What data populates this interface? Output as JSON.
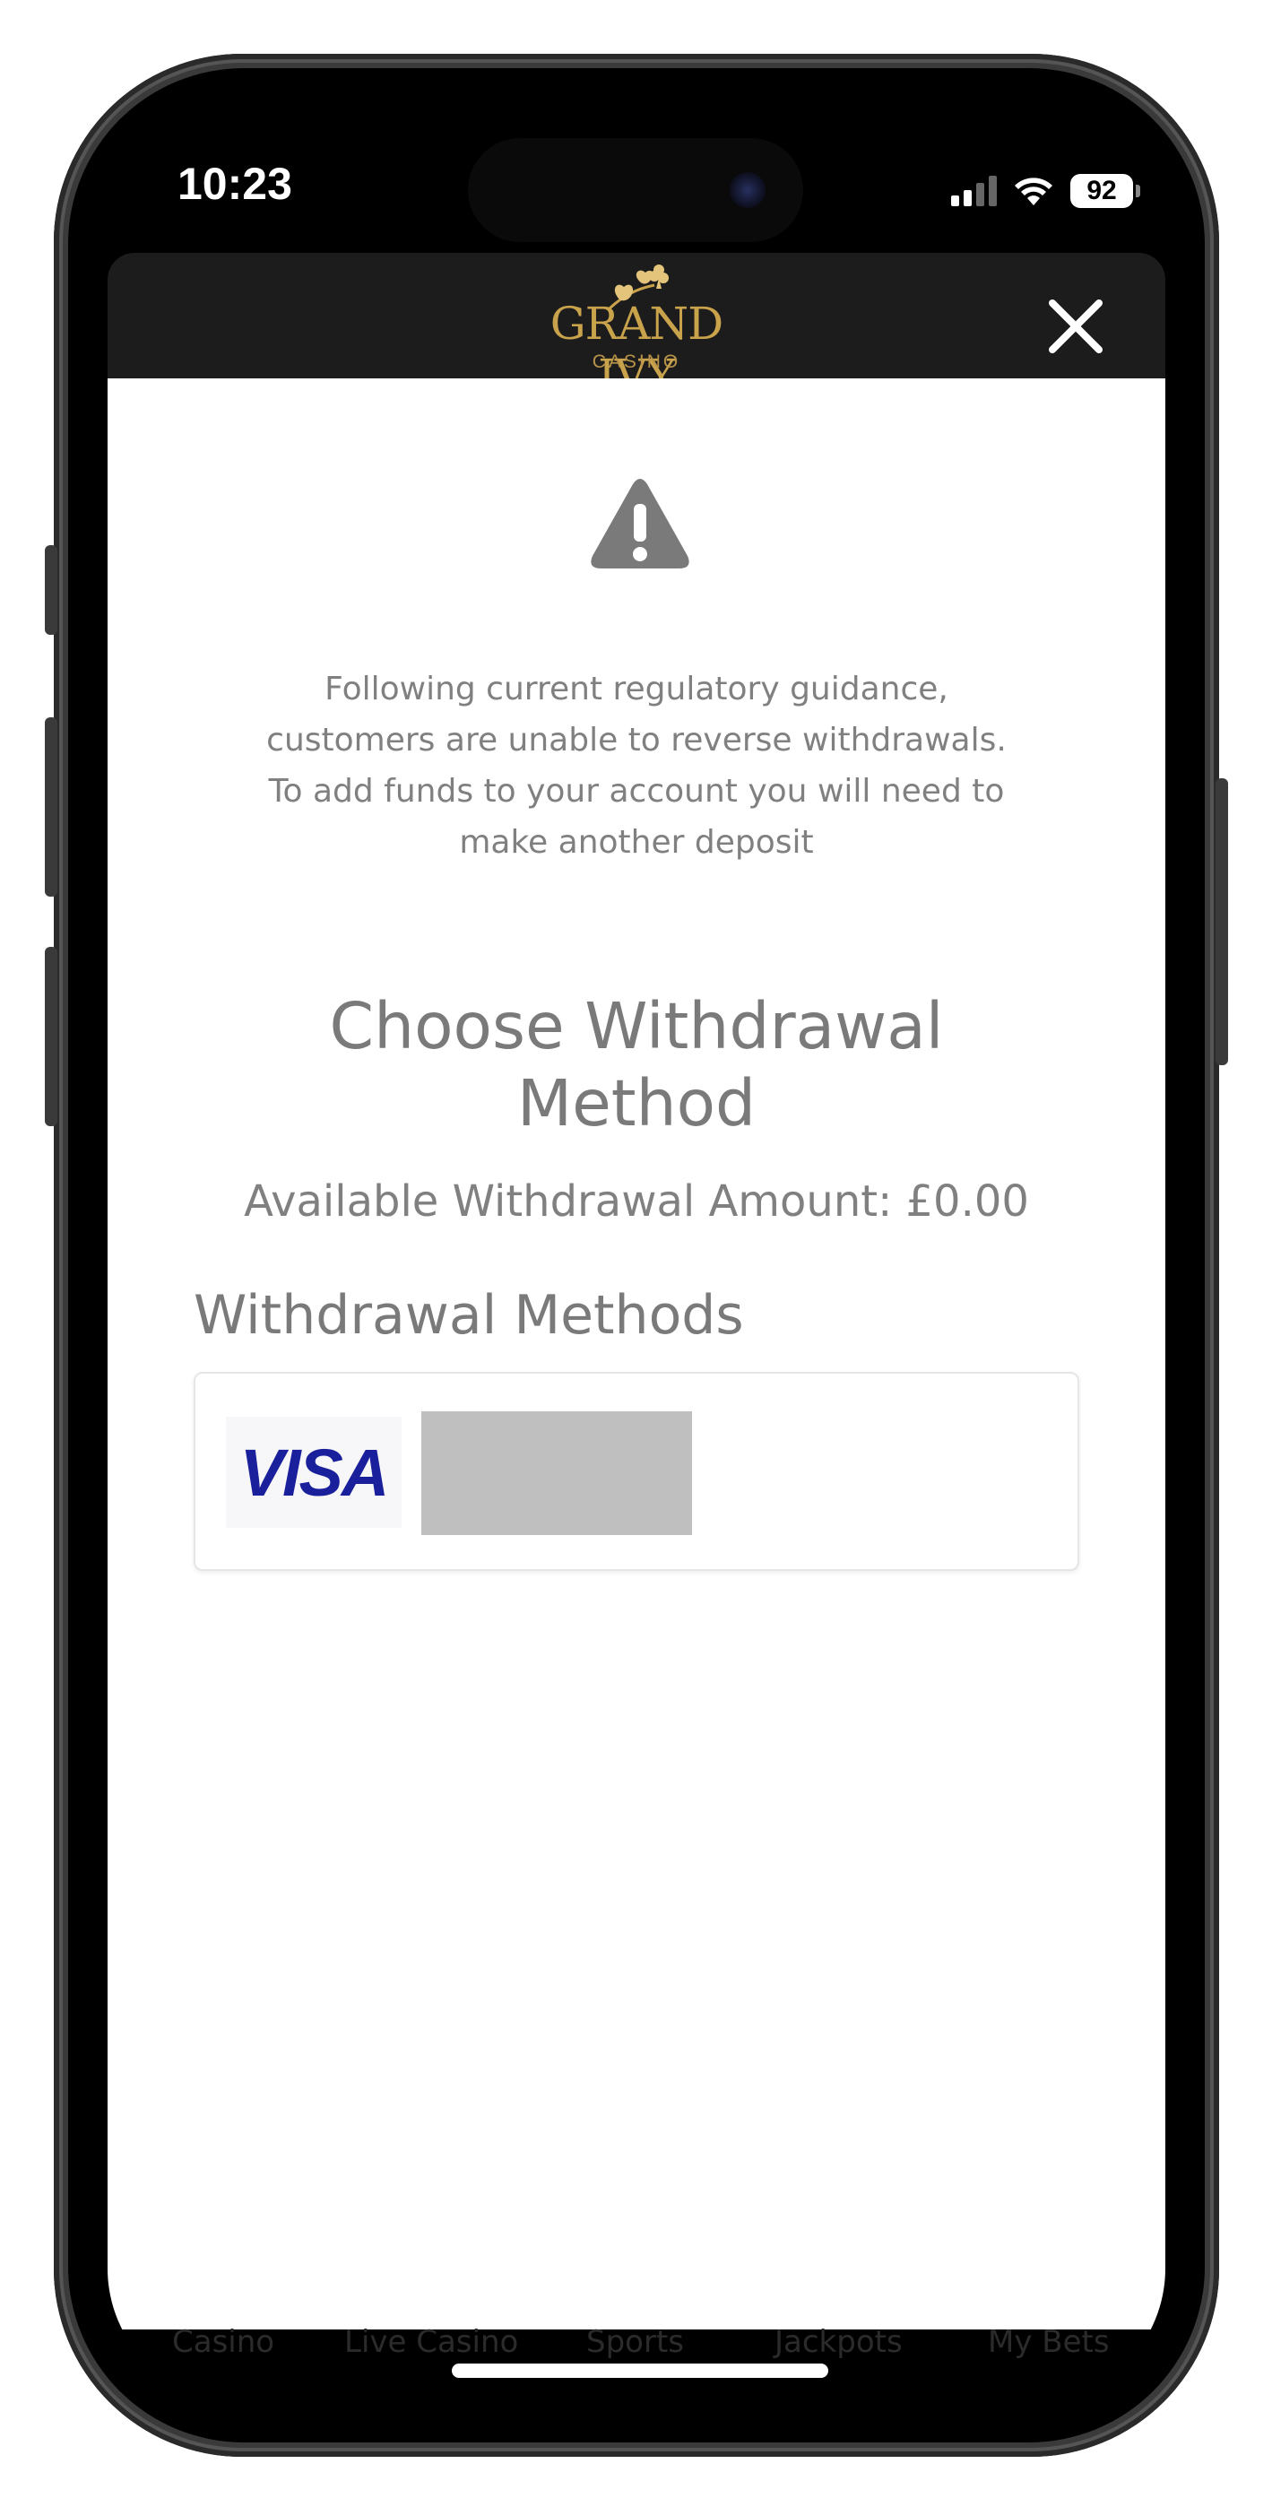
{
  "status_bar": {
    "time": "10:23",
    "battery": "92"
  },
  "header": {
    "logo_text": "GRAND IVY",
    "logo_subtext": "CASINO",
    "close_icon": "close-icon",
    "background": "#1c1c1c",
    "logo_color": "#c9a24c"
  },
  "notice": {
    "icon": "warning-icon",
    "line1": "Following current regulatory guidance,",
    "line2": "customers are unable to reverse withdrawals.",
    "line3": "To add funds to your account you will need to",
    "line4": "make another deposit"
  },
  "main": {
    "title_line1": "Choose Withdrawal",
    "title_line2": "Method",
    "available_label": "Available Withdrawal Amount: £0.00",
    "section_title": "Withdrawal Methods"
  },
  "methods": [
    {
      "brand": "VISA",
      "brand_color": "#1a1f9c"
    }
  ],
  "bottom_nav": {
    "items": [
      "Casino",
      "Live Casino",
      "Sports",
      "Jackpots",
      "My Bets"
    ]
  }
}
